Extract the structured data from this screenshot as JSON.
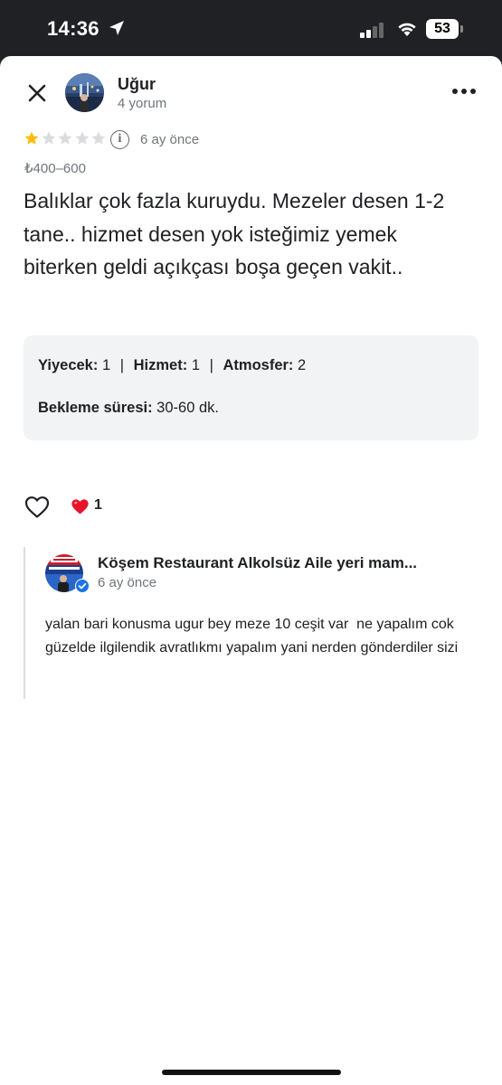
{
  "status_bar": {
    "time": "14:36",
    "battery": "53",
    "icons": [
      "location-arrow-icon",
      "cellular-signal-icon",
      "wifi-icon",
      "battery-icon"
    ]
  },
  "header": {
    "close_icon": "close-icon",
    "more_icon": "more-options-icon",
    "reviewer_name": "Uğur",
    "reviewer_meta": "4 yorum"
  },
  "review": {
    "rating": 1,
    "rating_max": 5,
    "date": "6 ay önce",
    "price_range": "₺400–600",
    "text": "Balıklar çok fazla kuruydu. Mezeler desen 1-2 tane.. hizmet desen yok isteğimiz yemek biterken geldi açıkçası boşa geçen vakit..",
    "attributes": {
      "food_label": "Yiyecek:",
      "food_value": "1",
      "service_label": "Hizmet:",
      "service_value": "1",
      "atmosphere_label": "Atmosfer:",
      "atmosphere_value": "2",
      "separator": "|",
      "wait_label": "Bekleme süresi:",
      "wait_value": "30-60 dk."
    }
  },
  "reactions": {
    "like_icon": "heart-outline-icon",
    "reaction_icon": "red-heart-icon",
    "count": "1"
  },
  "owner_reply": {
    "name": "Köşem Restaurant Alkolsüz Aile yeri mam...",
    "date": "6 ay önce",
    "text": "yalan bari konusma ugur bey meze 10 ceşit var  ne yapalım cok güzelde ilgilendik avratlıkmı yapalım yani nerden gönderdiler sizi",
    "badge_icon": "verified-badge-icon"
  },
  "colors": {
    "star_filled": "#fbbc04",
    "star_empty": "#dadce0",
    "heart_red": "#e8132b",
    "verified_blue": "#1a73e8",
    "panel_bg": "#f1f3f4",
    "secondary_text": "#70757a"
  }
}
